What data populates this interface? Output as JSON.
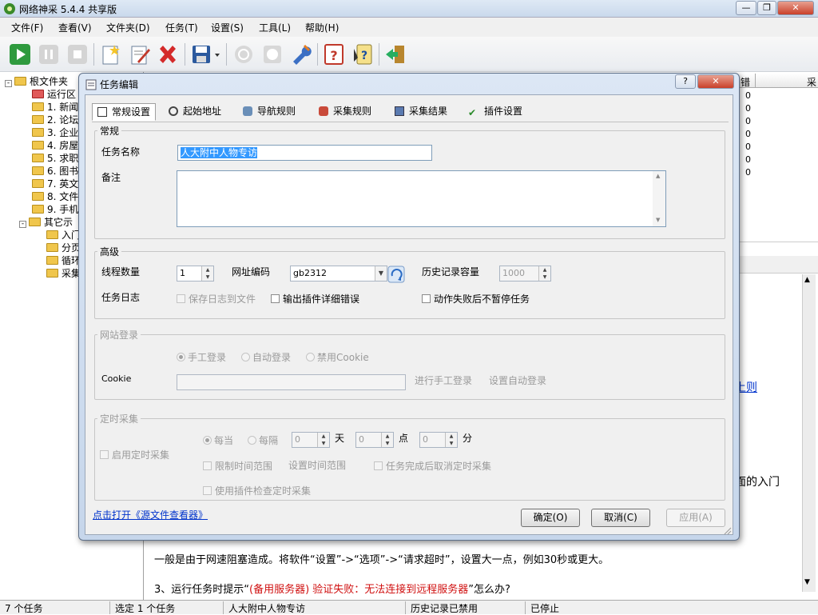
{
  "app": {
    "title": "网络神采 5.4.4 共享版"
  },
  "menu": [
    "文件(F)",
    "查看(V)",
    "文件夹(D)",
    "任务(T)",
    "设置(S)",
    "工具(L)",
    "帮助(H)"
  ],
  "toolbar": [
    "play-icon",
    "pause-icon",
    "stop-icon",
    "new-task-icon",
    "edit-task-icon",
    "delete-task-icon",
    "save-icon",
    "power-icon",
    "clock-icon",
    "wrench-icon",
    "help-icon",
    "context-help-icon",
    "exit-icon"
  ],
  "tree": {
    "root": "根文件夹",
    "running": "运行区",
    "items": [
      "1. 新闻",
      "2. 论坛",
      "3. 企业",
      "4. 房屋",
      "5. 求职",
      "6. 图书",
      "7. 英文",
      "8. 文件",
      "9. 手机"
    ],
    "other": "其它示",
    "other_items": [
      "入门",
      "分页",
      "循环",
      "采集"
    ]
  },
  "list": {
    "headers": {
      "err": "错",
      "last": "采"
    },
    "zeros": [
      "0",
      "0",
      "0",
      "0",
      "0",
      "0",
      "0"
    ]
  },
  "article": {
    "link_tail": "上则",
    "intro_tail": "面的入门",
    "para1": "一般是由于网速阻塞造成。将软件“设置”->“选项”->“请求超时”，设置大一点，例如30秒或更大。",
    "q3_prefix": "3、运行任务时提示“",
    "q3_red": "(备用服务器) 验证失败：无法连接到远程服务器",
    "q3_suffix": "”怎么办?"
  },
  "status": {
    "count": "7 个任务",
    "selected": "选定 1 个任务",
    "task": "人大附中人物专访",
    "history": "历史记录已禁用",
    "state": "已停止"
  },
  "dialog": {
    "title": "任务编辑",
    "tabs": [
      "常规设置",
      "起始地址",
      "导航规则",
      "采集规则",
      "采集结果",
      "插件设置"
    ],
    "general": {
      "group": "常规",
      "task_name_label": "任务名称",
      "task_name": "人大附中人物专访",
      "note_label": "备注",
      "note": ""
    },
    "advanced": {
      "group": "高级",
      "threads_label": "线程数量",
      "threads": "1",
      "encoding_label": "网址编码",
      "encoding": "gb2312",
      "history_label": "历史记录容量",
      "history": "1000",
      "log_label": "任务日志",
      "save_log": "保存日志到文件",
      "plugin_errors": "输出插件详细错误",
      "no_pause": "动作失败后不暂停任务"
    },
    "login": {
      "group": "网站登录",
      "manual": "手工登录",
      "auto": "自动登录",
      "disable_cookie": "禁用Cookie",
      "cookie_label": "Cookie",
      "cookie": "",
      "do_manual": "进行手工登录",
      "set_auto": "设置自动登录"
    },
    "schedule": {
      "group": "定时采集",
      "enable": "启用定时采集",
      "each": "每当",
      "every": "每隔",
      "day_val": "0",
      "day": "天",
      "hour_val": "0",
      "hour": "点",
      "min_val": "0",
      "min": "分",
      "limit_range": "限制时间范围",
      "set_range": "设置时间范围",
      "cancel_after": "任务完成后取消定时采集",
      "use_plugin": "使用插件检查定时采集"
    },
    "source_link": "点击打开《源文件查看器》",
    "buttons": {
      "ok": "确定(O)",
      "cancel": "取消(C)",
      "apply": "应用(A)"
    }
  }
}
